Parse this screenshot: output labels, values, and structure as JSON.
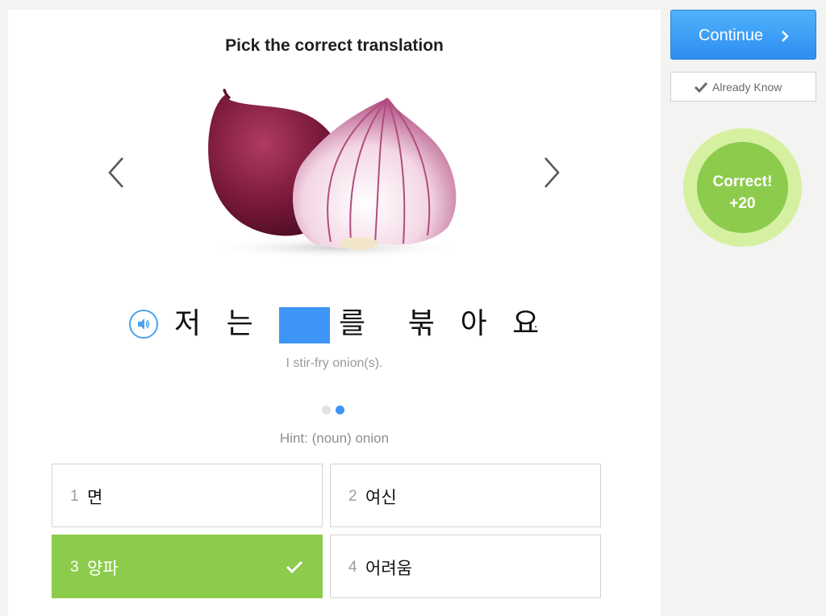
{
  "prompt": "Pick the correct translation",
  "image": {
    "icon": "red-onion-image"
  },
  "sentence": {
    "words": [
      "저 는",
      "를",
      "붂 아 요",
      "."
    ],
    "translation": "I stir-fry onion(s)."
  },
  "hint": "Hint: (noun) onion",
  "choices": [
    {
      "num": "1",
      "text": "면"
    },
    {
      "num": "2",
      "text": "여신"
    },
    {
      "num": "3",
      "text": "양파"
    },
    {
      "num": "4",
      "text": "어려움"
    }
  ],
  "actions": {
    "continue_label": "Continue",
    "already_know_label": "Already Know"
  },
  "feedback": {
    "title": "Correct!",
    "points": "+20"
  },
  "colors": {
    "accent_blue": "#3d95f6",
    "correct_green": "#8ccb4c",
    "badge_ring": "#d6f0a1"
  }
}
